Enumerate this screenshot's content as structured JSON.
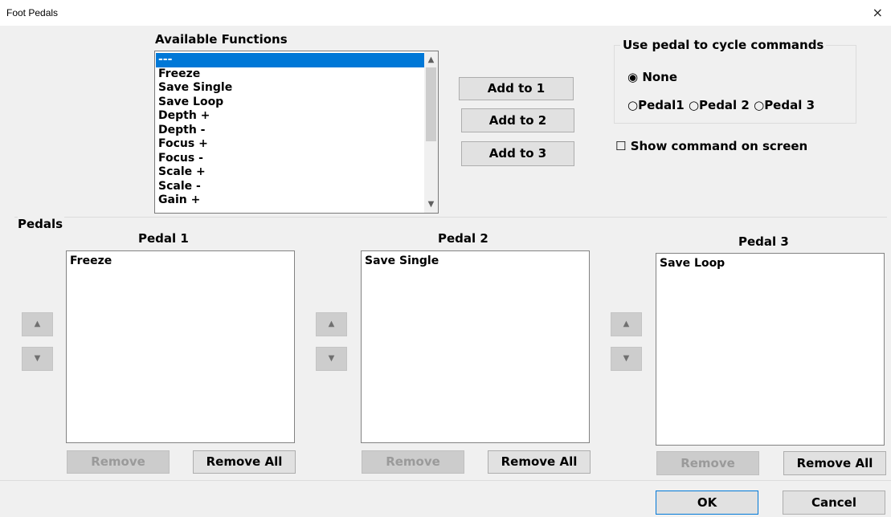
{
  "window": {
    "title": "Foot Pedals",
    "close_glyph": "×"
  },
  "available": {
    "label": "Available Functions",
    "items": [
      "---",
      "Freeze",
      "Save Single",
      "Save Loop",
      "Depth +",
      "Depth -",
      "Focus +",
      "Focus -",
      "Scale +",
      "Scale -",
      "Gain +"
    ],
    "selected_index": 0
  },
  "add_buttons": {
    "add1": "Add to 1",
    "add2": "Add to 2",
    "add3": "Add to 3"
  },
  "cycle": {
    "label": "Use pedal to cycle commands",
    "none": "None",
    "pedal1": "Pedal1",
    "pedal2": "Pedal 2",
    "pedal3": "Pedal 3",
    "selected": "None"
  },
  "show_command": {
    "label": "Show command on screen",
    "checked": false
  },
  "pedals": {
    "label": "Pedals",
    "p1": {
      "title": "Pedal 1",
      "items": [
        "Freeze"
      ]
    },
    "p2": {
      "title": "Pedal 2",
      "items": [
        "Save Single"
      ]
    },
    "p3": {
      "title": "Pedal 3",
      "items": [
        "Save Loop"
      ]
    },
    "remove_label": "Remove",
    "remove_all_label": "Remove All"
  },
  "footer": {
    "ok": "OK",
    "cancel": "Cancel"
  },
  "icons": {
    "radio_on": "◉",
    "radio_off": "○",
    "checkbox_off": "☐",
    "up": "▲",
    "down": "▼",
    "scroll_up": "^",
    "scroll_down": "v"
  }
}
